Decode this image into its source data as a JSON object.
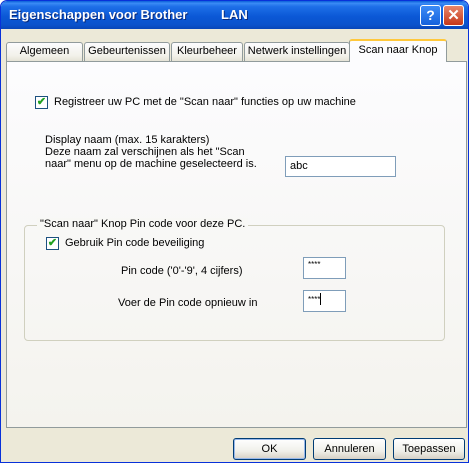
{
  "window": {
    "title": "Eigenschappen voor Brother",
    "title_suffix": "LAN",
    "help_label": "?",
    "close_label": "✕"
  },
  "tabs": [
    {
      "label": "Algemeen"
    },
    {
      "label": "Gebeurtenissen"
    },
    {
      "label": "Kleurbeheer"
    },
    {
      "label": "Netwerk instellingen"
    },
    {
      "label": "Scan naar Knop",
      "active": true
    }
  ],
  "register": {
    "checked": true,
    "check_glyph": "✔",
    "label": "Registreer uw PC met de \"Scan naar\" functies op uw machine"
  },
  "display_name": {
    "line1": "Display naam (max. 15 karakters)",
    "line2": "Deze naam zal verschijnen als het \"Scan",
    "line3": "naar\" menu op de machine geselecteerd is.",
    "value": "abc"
  },
  "pin_group": {
    "title": "\"Scan naar\" Knop Pin code voor deze PC.",
    "use_pin_checked": true,
    "use_pin_label": "Gebruik Pin code beveiliging",
    "pin_label": "Pin code ('0'-'9', 4 cijfers)",
    "pin_value": "****",
    "confirm_label": "Voer de Pin code opnieuw in",
    "confirm_value": "****"
  },
  "buttons": {
    "ok": "OK",
    "cancel": "Annuleren",
    "apply": "Toepassen"
  },
  "colors": {
    "titlebar": "#0a52cc",
    "dialog_bg": "#ece9d8",
    "active_tab_accent": "#ffc83c",
    "field_border": "#7f9db9"
  }
}
